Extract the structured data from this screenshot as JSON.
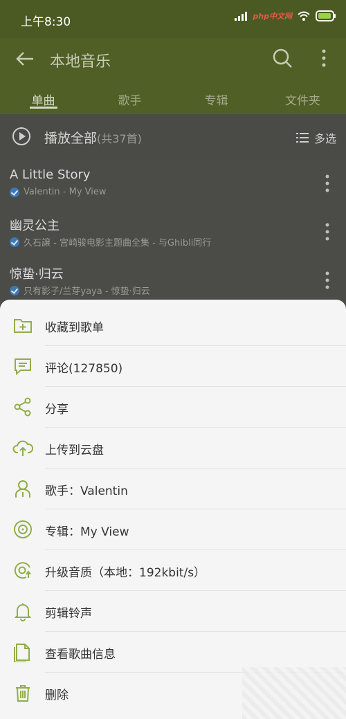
{
  "status_bar": {
    "time": "上午8:30",
    "watermark": "php中文网"
  },
  "app_bar": {
    "title": "本地音乐",
    "tabs": [
      {
        "label": "单曲",
        "active": true
      },
      {
        "label": "歌手",
        "active": false
      },
      {
        "label": "专辑",
        "active": false
      },
      {
        "label": "文件夹",
        "active": false
      }
    ]
  },
  "list": {
    "play_all_label": "播放全部",
    "play_all_count": "(共37首)",
    "multi_select_label": "多选",
    "songs": [
      {
        "title": "A Little Story",
        "meta": "Valentin - My View"
      },
      {
        "title": "幽灵公主",
        "meta": "久石譲 - 宫崎骏电影主题曲全集 - 与Ghibli同行"
      },
      {
        "title": "惊蛰·归云",
        "meta": "只有影子/兰芽yaya - 惊蛰·归云"
      }
    ]
  },
  "sheet": {
    "items": [
      {
        "label": "收藏到歌单",
        "icon": "add-folder-icon"
      },
      {
        "label": "评论(127850)",
        "icon": "comment-icon"
      },
      {
        "label": "分享",
        "icon": "share-icon"
      },
      {
        "label": "上传到云盘",
        "icon": "cloud-upload-icon"
      },
      {
        "label": "歌手：Valentin",
        "icon": "singer-icon"
      },
      {
        "label": "专辑：My View",
        "icon": "album-icon"
      },
      {
        "label": "升级音质（本地：192kbit/s）",
        "icon": "quality-icon"
      },
      {
        "label": "剪辑铃声",
        "icon": "bell-icon"
      },
      {
        "label": "查看歌曲信息",
        "icon": "file-info-icon"
      },
      {
        "label": "删除",
        "icon": "trash-icon"
      }
    ]
  },
  "colors": {
    "accent": "#8fae4a",
    "app_bar": "#4f5f25",
    "sheet_bg": "#f5f5f5"
  }
}
